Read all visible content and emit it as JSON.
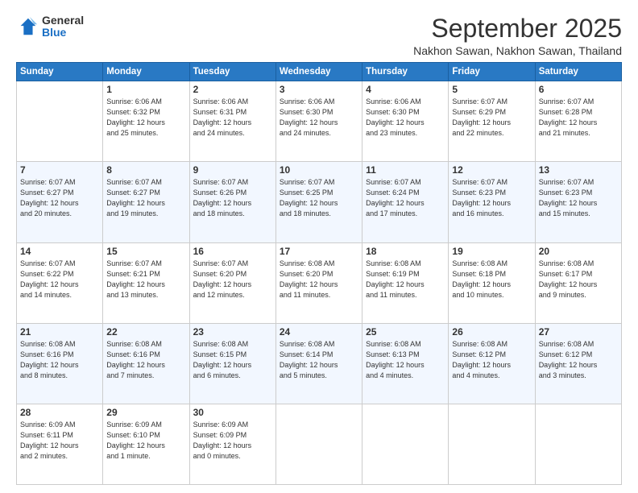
{
  "logo": {
    "general": "General",
    "blue": "Blue"
  },
  "header": {
    "month": "September 2025",
    "location": "Nakhon Sawan, Nakhon Sawan, Thailand"
  },
  "days_of_week": [
    "Sunday",
    "Monday",
    "Tuesday",
    "Wednesday",
    "Thursday",
    "Friday",
    "Saturday"
  ],
  "weeks": [
    [
      {
        "day": "",
        "info": ""
      },
      {
        "day": "1",
        "info": "Sunrise: 6:06 AM\nSunset: 6:32 PM\nDaylight: 12 hours\nand 25 minutes."
      },
      {
        "day": "2",
        "info": "Sunrise: 6:06 AM\nSunset: 6:31 PM\nDaylight: 12 hours\nand 24 minutes."
      },
      {
        "day": "3",
        "info": "Sunrise: 6:06 AM\nSunset: 6:30 PM\nDaylight: 12 hours\nand 24 minutes."
      },
      {
        "day": "4",
        "info": "Sunrise: 6:06 AM\nSunset: 6:30 PM\nDaylight: 12 hours\nand 23 minutes."
      },
      {
        "day": "5",
        "info": "Sunrise: 6:07 AM\nSunset: 6:29 PM\nDaylight: 12 hours\nand 22 minutes."
      },
      {
        "day": "6",
        "info": "Sunrise: 6:07 AM\nSunset: 6:28 PM\nDaylight: 12 hours\nand 21 minutes."
      }
    ],
    [
      {
        "day": "7",
        "info": "Sunrise: 6:07 AM\nSunset: 6:27 PM\nDaylight: 12 hours\nand 20 minutes."
      },
      {
        "day": "8",
        "info": "Sunrise: 6:07 AM\nSunset: 6:27 PM\nDaylight: 12 hours\nand 19 minutes."
      },
      {
        "day": "9",
        "info": "Sunrise: 6:07 AM\nSunset: 6:26 PM\nDaylight: 12 hours\nand 18 minutes."
      },
      {
        "day": "10",
        "info": "Sunrise: 6:07 AM\nSunset: 6:25 PM\nDaylight: 12 hours\nand 18 minutes."
      },
      {
        "day": "11",
        "info": "Sunrise: 6:07 AM\nSunset: 6:24 PM\nDaylight: 12 hours\nand 17 minutes."
      },
      {
        "day": "12",
        "info": "Sunrise: 6:07 AM\nSunset: 6:23 PM\nDaylight: 12 hours\nand 16 minutes."
      },
      {
        "day": "13",
        "info": "Sunrise: 6:07 AM\nSunset: 6:23 PM\nDaylight: 12 hours\nand 15 minutes."
      }
    ],
    [
      {
        "day": "14",
        "info": "Sunrise: 6:07 AM\nSunset: 6:22 PM\nDaylight: 12 hours\nand 14 minutes."
      },
      {
        "day": "15",
        "info": "Sunrise: 6:07 AM\nSunset: 6:21 PM\nDaylight: 12 hours\nand 13 minutes."
      },
      {
        "day": "16",
        "info": "Sunrise: 6:07 AM\nSunset: 6:20 PM\nDaylight: 12 hours\nand 12 minutes."
      },
      {
        "day": "17",
        "info": "Sunrise: 6:08 AM\nSunset: 6:20 PM\nDaylight: 12 hours\nand 11 minutes."
      },
      {
        "day": "18",
        "info": "Sunrise: 6:08 AM\nSunset: 6:19 PM\nDaylight: 12 hours\nand 11 minutes."
      },
      {
        "day": "19",
        "info": "Sunrise: 6:08 AM\nSunset: 6:18 PM\nDaylight: 12 hours\nand 10 minutes."
      },
      {
        "day": "20",
        "info": "Sunrise: 6:08 AM\nSunset: 6:17 PM\nDaylight: 12 hours\nand 9 minutes."
      }
    ],
    [
      {
        "day": "21",
        "info": "Sunrise: 6:08 AM\nSunset: 6:16 PM\nDaylight: 12 hours\nand 8 minutes."
      },
      {
        "day": "22",
        "info": "Sunrise: 6:08 AM\nSunset: 6:16 PM\nDaylight: 12 hours\nand 7 minutes."
      },
      {
        "day": "23",
        "info": "Sunrise: 6:08 AM\nSunset: 6:15 PM\nDaylight: 12 hours\nand 6 minutes."
      },
      {
        "day": "24",
        "info": "Sunrise: 6:08 AM\nSunset: 6:14 PM\nDaylight: 12 hours\nand 5 minutes."
      },
      {
        "day": "25",
        "info": "Sunrise: 6:08 AM\nSunset: 6:13 PM\nDaylight: 12 hours\nand 4 minutes."
      },
      {
        "day": "26",
        "info": "Sunrise: 6:08 AM\nSunset: 6:12 PM\nDaylight: 12 hours\nand 4 minutes."
      },
      {
        "day": "27",
        "info": "Sunrise: 6:08 AM\nSunset: 6:12 PM\nDaylight: 12 hours\nand 3 minutes."
      }
    ],
    [
      {
        "day": "28",
        "info": "Sunrise: 6:09 AM\nSunset: 6:11 PM\nDaylight: 12 hours\nand 2 minutes."
      },
      {
        "day": "29",
        "info": "Sunrise: 6:09 AM\nSunset: 6:10 PM\nDaylight: 12 hours\nand 1 minute."
      },
      {
        "day": "30",
        "info": "Sunrise: 6:09 AM\nSunset: 6:09 PM\nDaylight: 12 hours\nand 0 minutes."
      },
      {
        "day": "",
        "info": ""
      },
      {
        "day": "",
        "info": ""
      },
      {
        "day": "",
        "info": ""
      },
      {
        "day": "",
        "info": ""
      }
    ]
  ]
}
